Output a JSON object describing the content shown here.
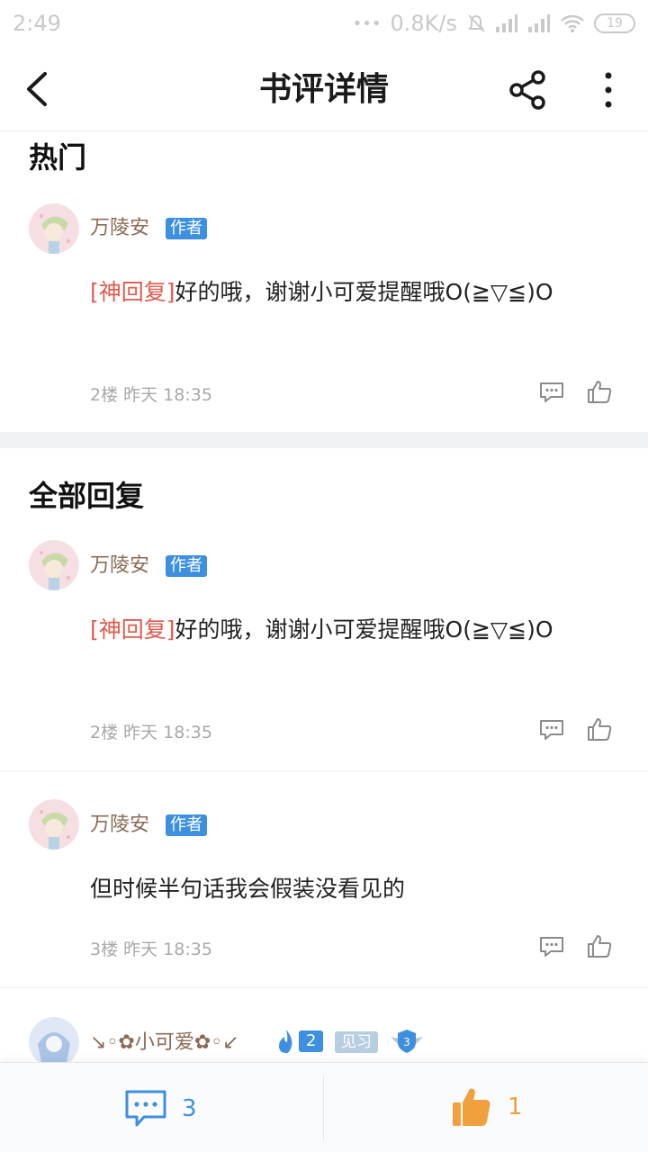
{
  "status_bar": {
    "time": "2:49",
    "network_speed": "0.8K/s",
    "battery": "19",
    "dots": "•••"
  },
  "header": {
    "title": "书评详情",
    "back_icon": "chevron-left-icon",
    "share_icon": "share-icon",
    "more_icon": "more-vertical-icon"
  },
  "hot_section": {
    "title": "热门",
    "comments": [
      {
        "username": "万陵安",
        "badge": "作者",
        "reply_tag": "[神回复]",
        "text": "好的哦，谢谢小可爱提醒哦O(≧▽≦)O",
        "floor": "2楼",
        "time": "昨天 18:35"
      }
    ]
  },
  "all_section": {
    "title": "全部回复",
    "comments": [
      {
        "username": "万陵安",
        "badge": "作者",
        "reply_tag": "[神回复]",
        "text": "好的哦，谢谢小可爱提醒哦O(≧▽≦)O",
        "floor": "2楼",
        "time": "昨天 18:35"
      },
      {
        "username": "万陵安",
        "badge": "作者",
        "reply_tag": "",
        "text": "但时候半句话我会假装没看见的",
        "floor": "3楼",
        "time": "昨天 18:35"
      }
    ],
    "partial_user": {
      "username": "↘◦✿小可爱✿◦↙",
      "fans_level": "2",
      "level_title": "见习",
      "shield_level": "3"
    }
  },
  "bottom_bar": {
    "comment_count": "3",
    "like_count": "1"
  },
  "colors": {
    "accent_blue": "#3d8fe0",
    "reply_tag_red": "#e05a4e",
    "username_brown": "#8b6a56",
    "like_orange": "#f0a03c"
  }
}
